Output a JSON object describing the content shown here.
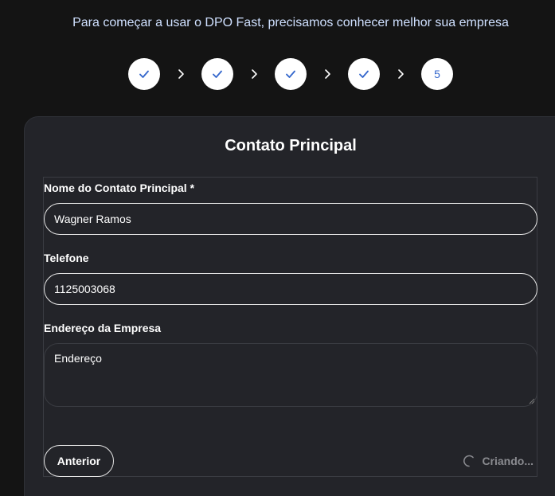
{
  "header": {
    "subtitle": "Para começar a usar o DPO Fast, precisamos conhecer melhor sua empresa"
  },
  "stepper": {
    "steps": [
      {
        "state": "completed",
        "icon": "check-icon"
      },
      {
        "state": "completed",
        "icon": "check-icon"
      },
      {
        "state": "completed",
        "icon": "check-icon"
      },
      {
        "state": "completed",
        "icon": "check-icon"
      },
      {
        "state": "current",
        "label": "5"
      }
    ],
    "separator_icon": "chevron-right-icon"
  },
  "card": {
    "title": "Contato Principal"
  },
  "form": {
    "contact_name": {
      "label": "Nome do Contato Principal *",
      "value": "Wagner Ramos"
    },
    "phone": {
      "label": "Telefone",
      "value": "1125003068"
    },
    "address": {
      "label": "Endereço da Empresa",
      "placeholder": "Endereço",
      "value": ""
    }
  },
  "actions": {
    "previous_label": "Anterior",
    "submit_loading_label": "Criando...",
    "loading_icon": "spinner-icon"
  },
  "colors": {
    "background": "#141414",
    "card": "#232429",
    "step_circle": "#ffffff",
    "step_accent": "#3366cc",
    "subtitle": "#cfe0ff",
    "muted": "#8a8b90"
  }
}
